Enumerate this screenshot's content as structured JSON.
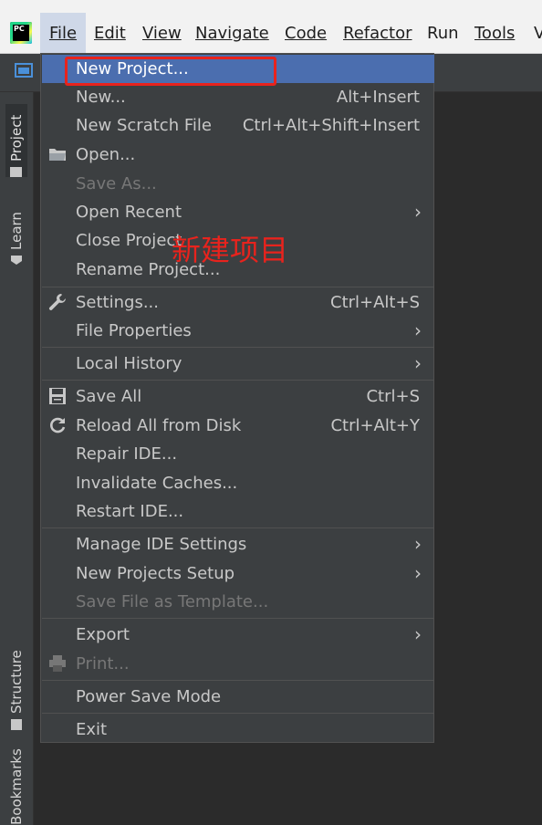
{
  "menubar": {
    "logo_text": "PC",
    "items": [
      "File",
      "Edit",
      "View",
      "Navigate",
      "Code",
      "Refactor",
      "Run",
      "Tools",
      "V"
    ]
  },
  "sidebar": {
    "tabs": [
      "Project",
      "Learn",
      "Structure",
      "Bookmarks"
    ]
  },
  "file_menu": {
    "items": [
      {
        "label": "New Project...",
        "shortcut": "",
        "icon": ""
      },
      {
        "label": "New...",
        "shortcut": "Alt+Insert",
        "icon": ""
      },
      {
        "label": "New Scratch File",
        "shortcut": "Ctrl+Alt+Shift+Insert",
        "icon": ""
      },
      {
        "label": "Open...",
        "shortcut": "",
        "icon": "folder-icon"
      },
      {
        "label": "Save As...",
        "shortcut": "",
        "icon": ""
      },
      {
        "label": "Open Recent",
        "shortcut": "",
        "icon": "",
        "submenu": true
      },
      {
        "label": "Close Project",
        "shortcut": "",
        "icon": ""
      },
      {
        "label": "Rename Project...",
        "shortcut": "",
        "icon": ""
      },
      {
        "label": "Settings...",
        "shortcut": "Ctrl+Alt+S",
        "icon": "wrench-icon"
      },
      {
        "label": "File Properties",
        "shortcut": "",
        "icon": "",
        "submenu": true
      },
      {
        "label": "Local History",
        "shortcut": "",
        "icon": "",
        "submenu": true
      },
      {
        "label": "Save All",
        "shortcut": "Ctrl+S",
        "icon": "save-icon"
      },
      {
        "label": "Reload All from Disk",
        "shortcut": "Ctrl+Alt+Y",
        "icon": "reload-icon"
      },
      {
        "label": "Repair IDE...",
        "shortcut": "",
        "icon": ""
      },
      {
        "label": "Invalidate Caches...",
        "shortcut": "",
        "icon": ""
      },
      {
        "label": "Restart IDE...",
        "shortcut": "",
        "icon": ""
      },
      {
        "label": "Manage IDE Settings",
        "shortcut": "",
        "icon": "",
        "submenu": true
      },
      {
        "label": "New Projects Setup",
        "shortcut": "",
        "icon": "",
        "submenu": true
      },
      {
        "label": "Save File as Template...",
        "shortcut": "",
        "icon": ""
      },
      {
        "label": "Export",
        "shortcut": "",
        "icon": "",
        "submenu": true
      },
      {
        "label": "Print...",
        "shortcut": "",
        "icon": "printer-icon"
      },
      {
        "label": "Power Save Mode",
        "shortcut": "",
        "icon": ""
      },
      {
        "label": "Exit",
        "shortcut": "",
        "icon": ""
      }
    ]
  },
  "annotation": {
    "text": "新建项目",
    "color": "#e8231d"
  },
  "colors": {
    "menu_bg": "#3c3f41",
    "selection": "#4b6eaf",
    "editor_bg": "#2b2b2b"
  }
}
